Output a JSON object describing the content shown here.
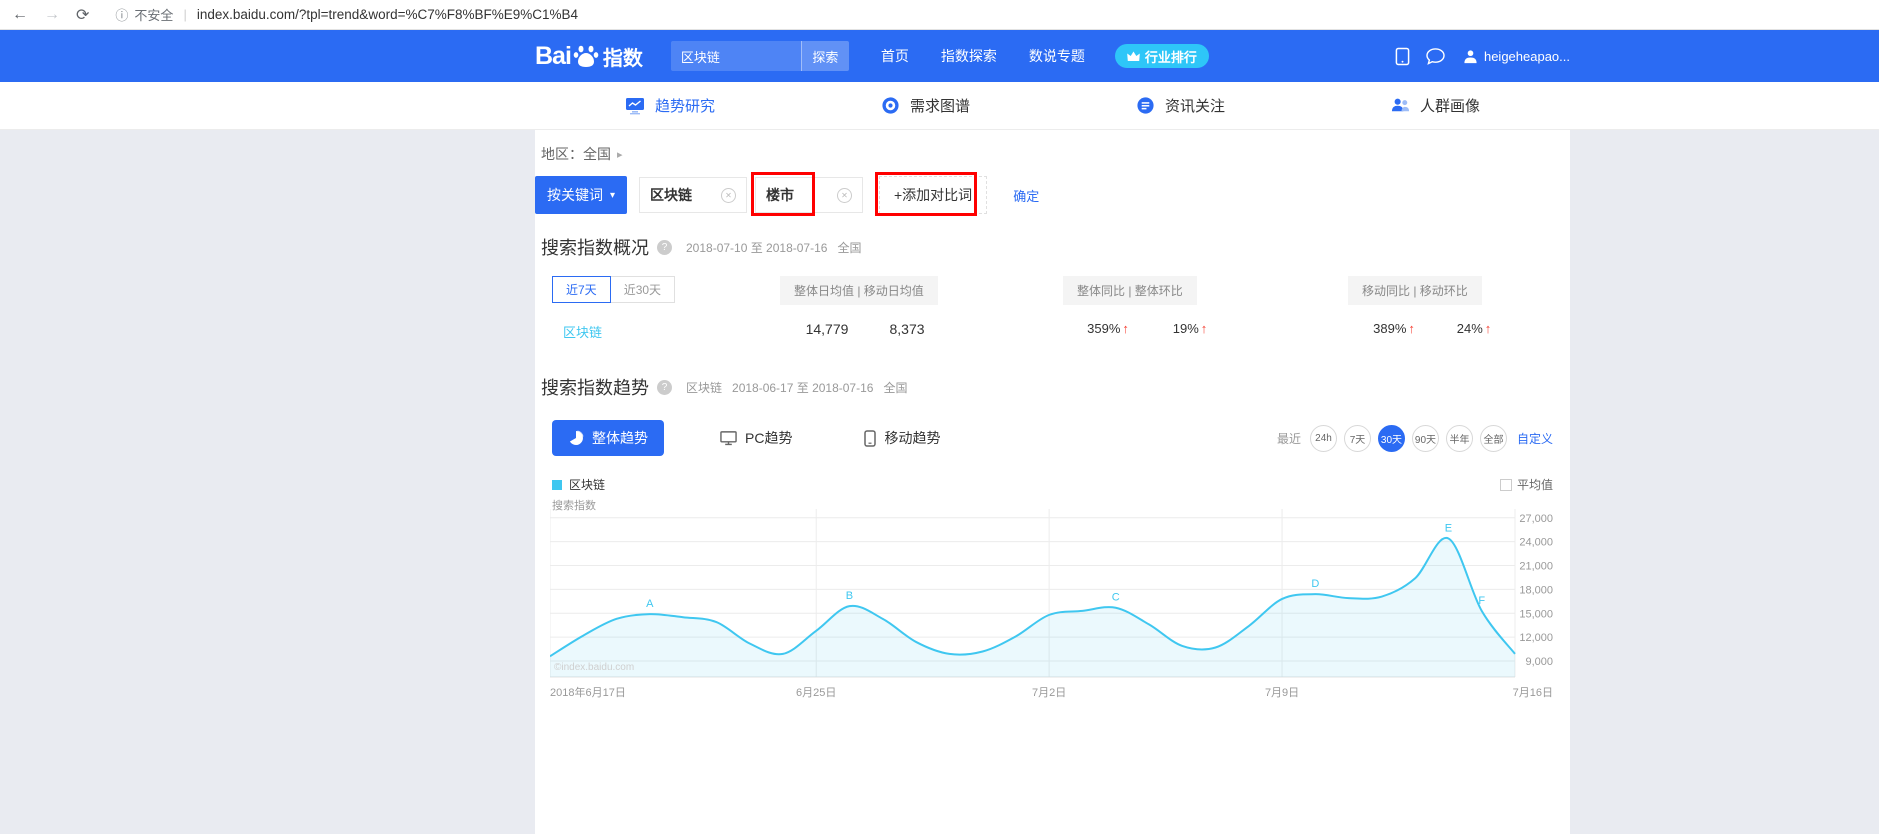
{
  "browser": {
    "security_label": "不安全",
    "url": "index.baidu.com/?tpl=trend&word=%C7%F8%BF%E9%C1%B4"
  },
  "icons": {
    "back_arrow": "←",
    "forward_arrow": "→",
    "reload": "⟳",
    "info": "ⓘ",
    "url_divider": "|",
    "region_arrow": "▸",
    "caret_down": "▾",
    "remove_x": "✕",
    "help": "?",
    "up_arrow": "↑"
  },
  "colors": {
    "accent_blue": "#2b6bf3",
    "badge_cyan": "#2ec6f8",
    "chart_line": "#3fc7f0",
    "positive_arrow": "#f54336",
    "annotation_box": "#ff0000"
  },
  "header": {
    "logo_text": "Bai",
    "logo_suffix": "指数",
    "search_value": "区块链",
    "search_button": "探索",
    "nav_home": "首页",
    "nav_explore": "指数探索",
    "nav_topics": "数说专题",
    "rank_badge": "行业排行",
    "username": "heigeheapao..."
  },
  "subnav": {
    "trend": "趋势研究",
    "demand": "需求图谱",
    "news": "资讯关注",
    "portrait": "人群画像"
  },
  "filters": {
    "region": "地区：全国",
    "mode_button": "按关键词",
    "keyword_1": "区块链",
    "keyword_2": "楼市",
    "add_compare": "+添加对比词",
    "confirm": "确定"
  },
  "overview": {
    "title": "搜索指数概况",
    "date_range": "2018-07-10 至 2018-07-16",
    "region": "全国",
    "tab_7d": "近7天",
    "tab_30d": "近30天",
    "header_daily": "整体日均值 | 移动日均值",
    "header_overall": "整体同比 | 整体环比",
    "header_mobile": "移动同比 | 移动环比",
    "keyword": "区块链",
    "overall_daily_avg": "14,779",
    "mobile_daily_avg": "8,373",
    "overall_yoy": "359%",
    "overall_qoq": "19%",
    "mobile_yoy": "389%",
    "mobile_qoq": "24%"
  },
  "trend": {
    "title": "搜索指数趋势",
    "keyword": "区块链",
    "date_range": "2018-06-17 至 2018-07-16",
    "region": "全国",
    "tab_overall": "整体趋势",
    "tab_pc": "PC趋势",
    "tab_mobile": "移动趋势",
    "recent_label": "最近",
    "range_24h": "24h",
    "range_7d": "7天",
    "range_30d": "30天",
    "range_90d": "90天",
    "range_half_year": "半年",
    "range_all": "全部",
    "range_custom": "自定义",
    "legend_keyword": "区块链",
    "average_label": "平均值"
  },
  "chart_data": {
    "type": "line",
    "title": "搜索指数趋势",
    "ylabel": "搜索指数",
    "watermark": "©index.baidu.com",
    "legend_position": "top-left",
    "grid": true,
    "series": [
      {
        "name": "区块链",
        "color": "#3fc7f0",
        "values": [
          9600,
          12200,
          14300,
          14900,
          14500,
          13900,
          11200,
          9900,
          12800,
          15900,
          14300,
          11400,
          9900,
          10200,
          12100,
          14800,
          15300,
          15700,
          13600,
          10900,
          10700,
          13400,
          16800,
          17400,
          16900,
          17100,
          19400,
          24400,
          15300,
          9900
        ]
      }
    ],
    "x": [
      "2018-06-17",
      "2018-06-18",
      "2018-06-19",
      "2018-06-20",
      "2018-06-21",
      "2018-06-22",
      "2018-06-23",
      "2018-06-24",
      "2018-06-25",
      "2018-06-26",
      "2018-06-27",
      "2018-06-28",
      "2018-06-29",
      "2018-06-30",
      "2018-07-01",
      "2018-07-02",
      "2018-07-03",
      "2018-07-04",
      "2018-07-05",
      "2018-07-06",
      "2018-07-07",
      "2018-07-08",
      "2018-07-09",
      "2018-07-10",
      "2018-07-11",
      "2018-07-12",
      "2018-07-13",
      "2018-07-14",
      "2018-07-15",
      "2018-07-16"
    ],
    "x_tick_indices": [
      0,
      8,
      15,
      22,
      29
    ],
    "x_tick_labels": [
      "2018年6月17日",
      "6月25日",
      "7月2日",
      "7月9日",
      "7月16日"
    ],
    "y_ticks": [
      9000,
      12000,
      15000,
      18000,
      21000,
      24000,
      27000
    ],
    "y_tick_labels": [
      "9,000",
      "12,000",
      "15,000",
      "18,000",
      "21,000",
      "24,000",
      "27,000"
    ],
    "ylim": [
      8000,
      27600
    ],
    "annotations": [
      {
        "label": "A",
        "index": 3
      },
      {
        "label": "B",
        "index": 9
      },
      {
        "label": "C",
        "index": 17
      },
      {
        "label": "D",
        "index": 23
      },
      {
        "label": "E",
        "index": 27
      },
      {
        "label": "F",
        "index": 28
      }
    ]
  }
}
